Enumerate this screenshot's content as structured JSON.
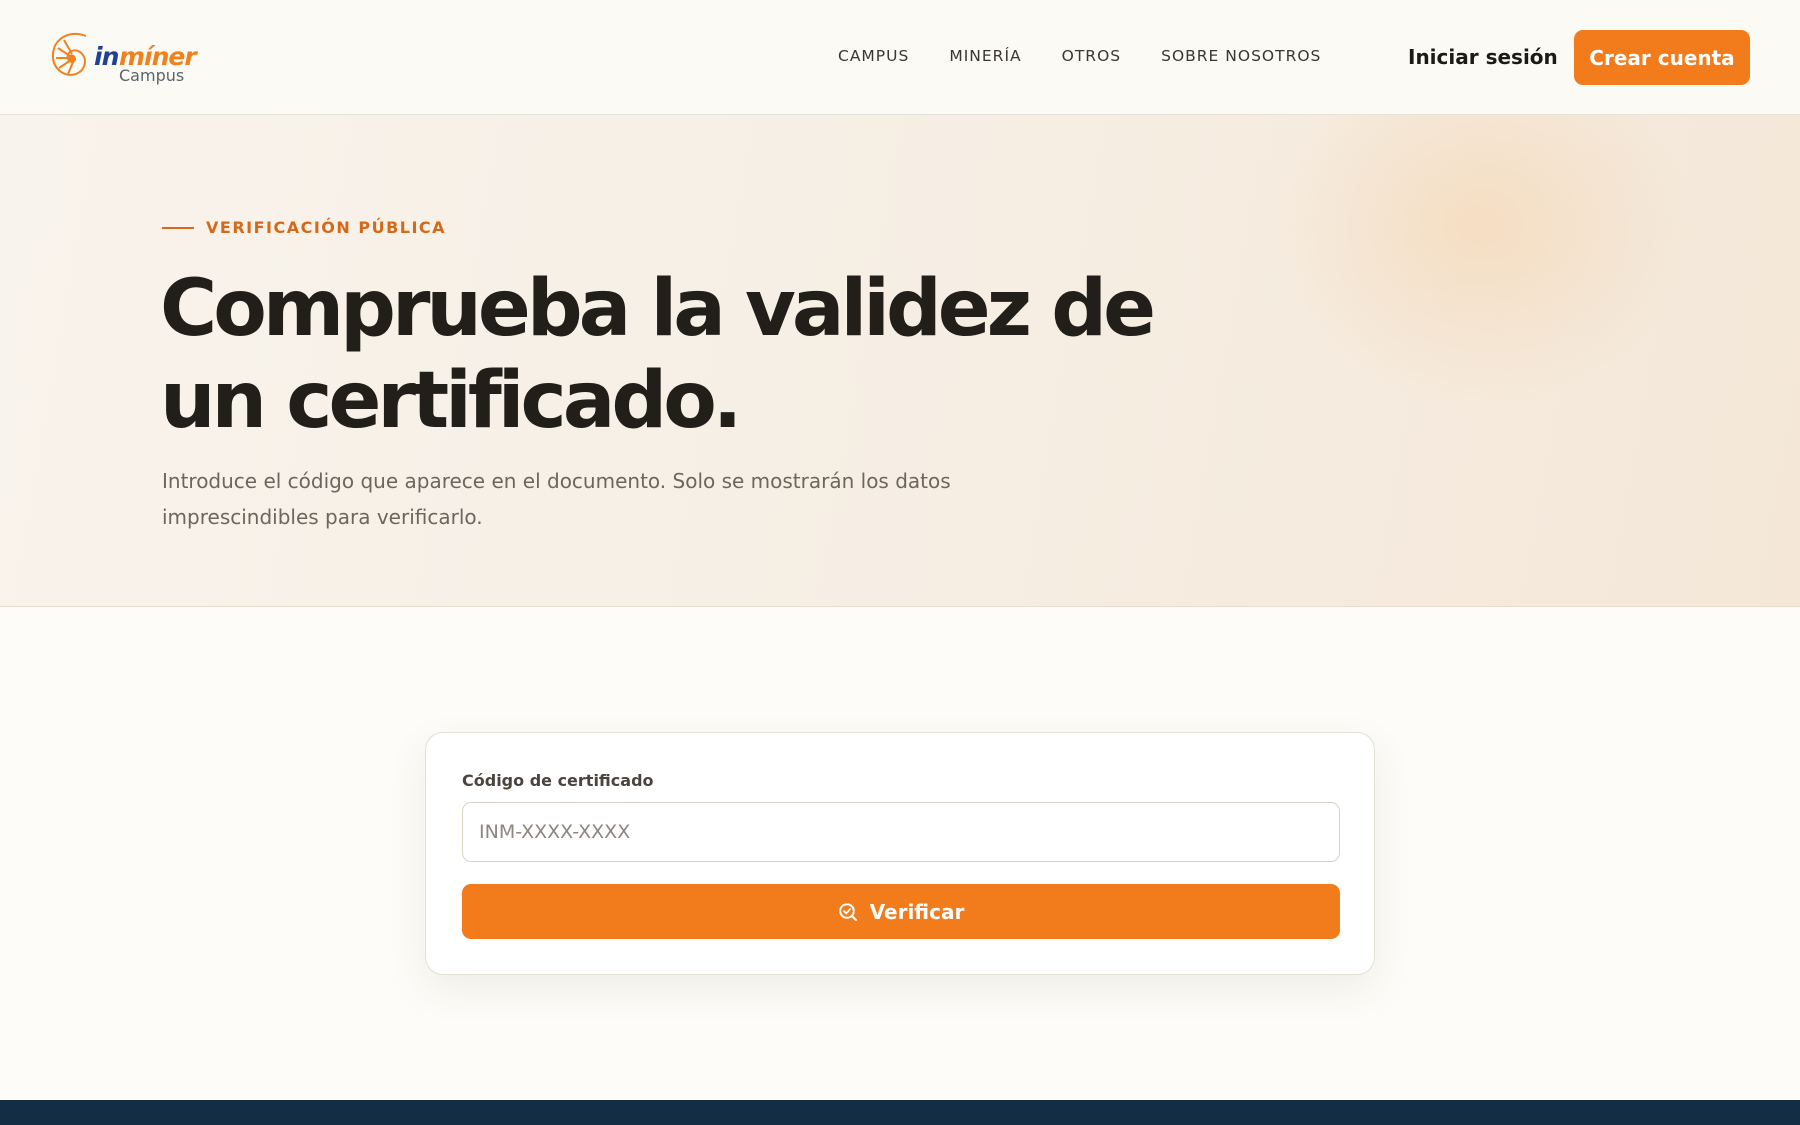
{
  "brand": {
    "logo_text_primary": "in",
    "logo_text_accent": "míner",
    "logo_subtext": "Campus",
    "colors": {
      "accent": "#f27b1b",
      "brand_blue": "#1f3f99",
      "footer": "#132d44"
    }
  },
  "nav": {
    "items": [
      {
        "label": "CAMPUS"
      },
      {
        "label": "MINERÍA"
      },
      {
        "label": "OTROS"
      },
      {
        "label": "SOBRE NOSOTROS"
      }
    ],
    "login_label": "Iniciar sesión",
    "signup_label": "Crear cuenta"
  },
  "hero": {
    "eyebrow": "VERIFICACIÓN PÚBLICA",
    "title_line1": "Comprueba la validez de",
    "title_line2": "un certificado.",
    "subtitle": "Introduce el código que aparece en el documento. Solo se mostrarán los datos imprescindibles para verificarlo."
  },
  "verify_form": {
    "field_label": "Código de certificado",
    "input_value": "",
    "input_placeholder": "INM-XXXX-XXXX",
    "button_label": "Verificar",
    "button_icon": "search-check-icon"
  }
}
